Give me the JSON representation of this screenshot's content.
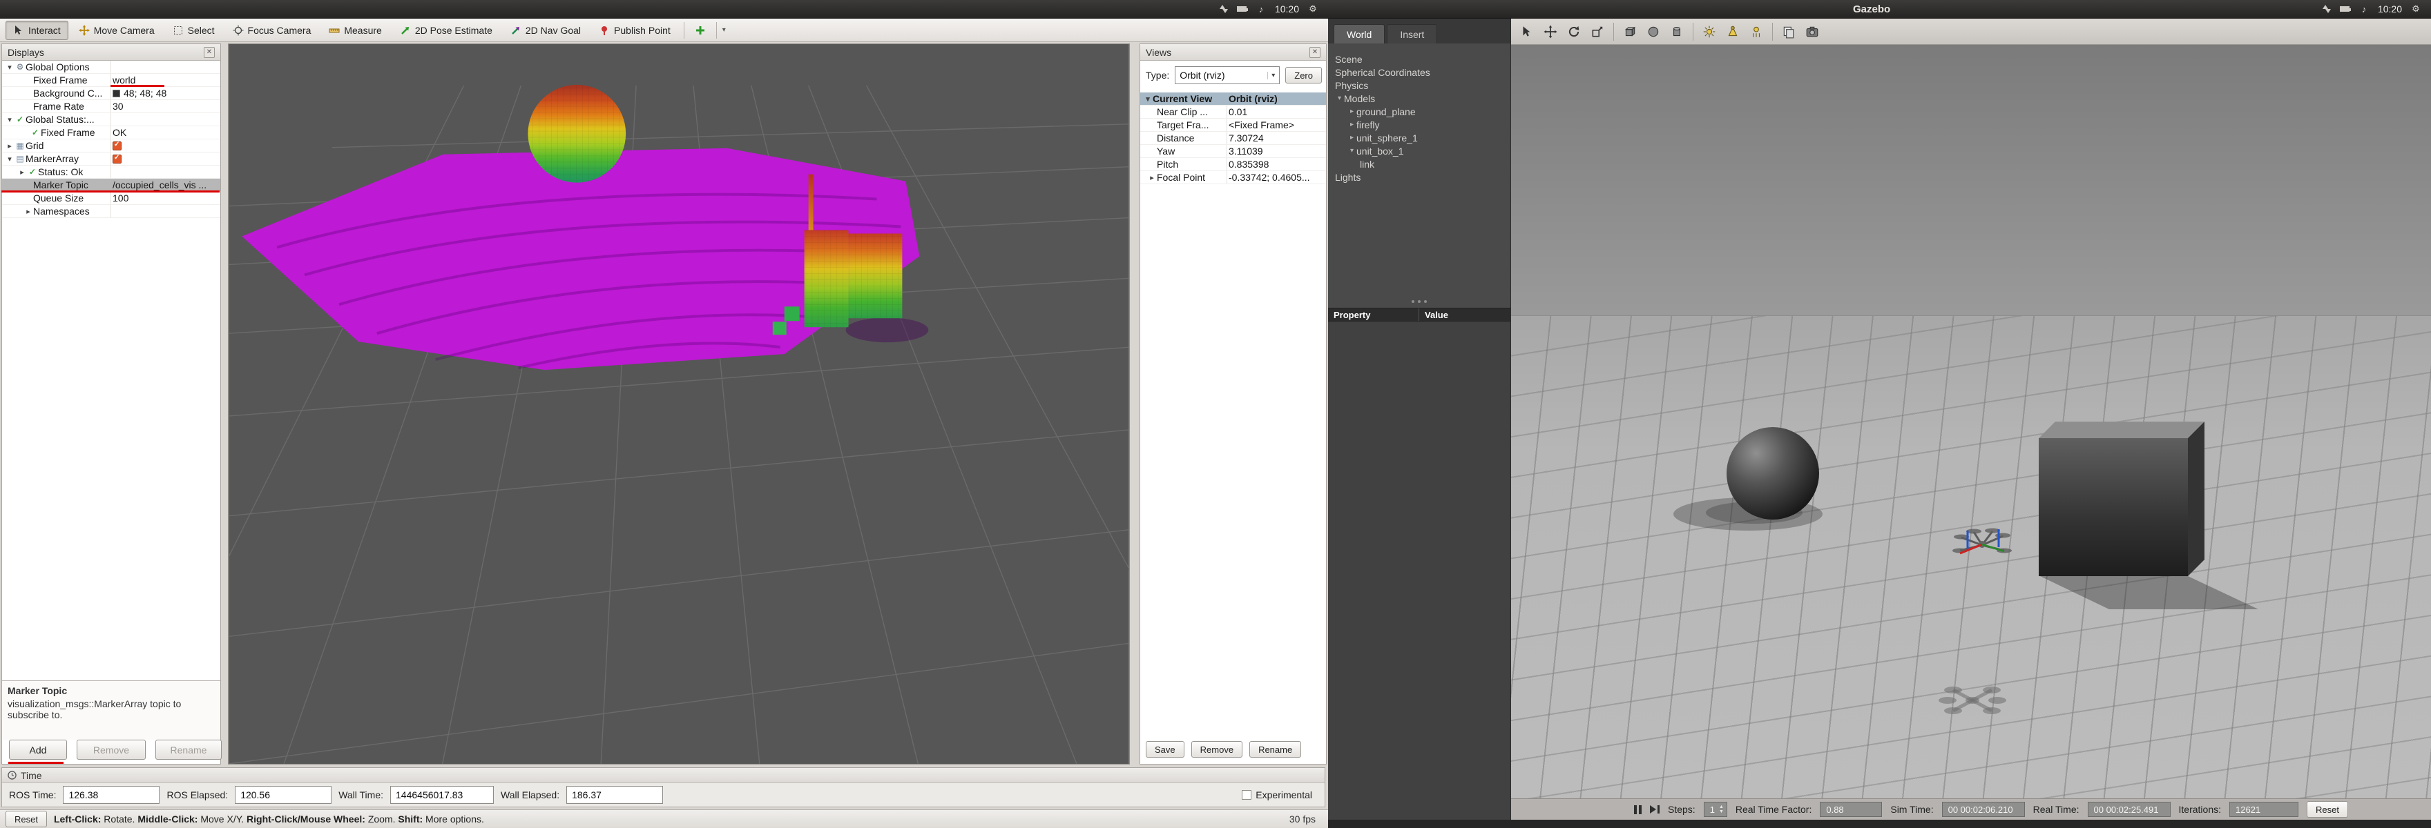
{
  "panel": {
    "gazebo_title": "Gazebo",
    "clock_left": "10:20",
    "clock_right": "10:20"
  },
  "icons": [
    "interact-icon",
    "move-camera-icon",
    "select-icon",
    "focus-camera-icon",
    "measure-icon",
    "pose-estimate-icon",
    "nav-goal-icon",
    "publish-point-icon",
    "add-tool-icon",
    "chevron-down-icon",
    "close-icon",
    "gear-icon",
    "grid-icon",
    "markerarray-icon",
    "status-check-icon",
    "expander-icon",
    "clock-icon",
    "network-icon",
    "battery-icon",
    "sound-icon",
    "session-gear-icon",
    "select-arrow-icon",
    "translate-icon",
    "rotate-icon",
    "scale-icon",
    "cube-icon",
    "sphere-icon",
    "cylinder-icon",
    "pointlight-icon",
    "spotlight-icon",
    "directionallight-icon",
    "screenshot-icon",
    "copy-icon",
    "pause-icon",
    "step-icon"
  ],
  "rviz": {
    "toolbar": {
      "buttons": [
        "Interact",
        "Move Camera",
        "Select",
        "Focus Camera",
        "Measure",
        "2D Pose Estimate",
        "2D Nav Goal",
        "Publish Point"
      ]
    },
    "displays": {
      "title": "Displays",
      "rows": [
        {
          "label": "Global Options"
        },
        {
          "label": "Fixed Frame",
          "value": "world"
        },
        {
          "label": "Background C...",
          "value": "48; 48; 48"
        },
        {
          "label": "Frame Rate",
          "value": "30"
        },
        {
          "label": "Global Status:..."
        },
        {
          "label": "Fixed Frame",
          "value": "OK"
        },
        {
          "label": "Grid"
        },
        {
          "label": "MarkerArray"
        },
        {
          "label": "Status: Ok"
        },
        {
          "label": "Marker Topic",
          "value": "/occupied_cells_vis ..."
        },
        {
          "label": "Queue Size",
          "value": "100"
        },
        {
          "label": "Namespaces"
        }
      ],
      "help_title": "Marker Topic",
      "help_body": "visualization_msgs::MarkerArray topic to subscribe to.",
      "add": "Add",
      "remove": "Remove",
      "rename": "Rename"
    },
    "views": {
      "title": "Views",
      "type_label": "Type:",
      "type_value": "Orbit (rviz)",
      "zero": "Zero",
      "rows": [
        {
          "label": "Current View",
          "value": "Orbit (rviz)"
        },
        {
          "label": "Near Clip ...",
          "value": "0.01"
        },
        {
          "label": "Target Fra...",
          "value": "<Fixed Frame>"
        },
        {
          "label": "Distance",
          "value": "7.30724"
        },
        {
          "label": "Yaw",
          "value": "3.11039"
        },
        {
          "label": "Pitch",
          "value": "0.835398"
        },
        {
          "label": "Focal Point",
          "value": "-0.33742; 0.4605..."
        }
      ],
      "save": "Save",
      "remove": "Remove",
      "rename": "Rename"
    },
    "time_panel": {
      "title": "Time",
      "ros_time_label": "ROS Time:",
      "ros_time": "126.38",
      "ros_elapsed_label": "ROS Elapsed:",
      "ros_elapsed": "120.56",
      "wall_time_label": "Wall Time:",
      "wall_time": "1446456017.83",
      "wall_elapsed_label": "Wall Elapsed:",
      "wall_elapsed": "186.37",
      "experimental": "Experimental"
    },
    "statusbar": {
      "reset": "Reset",
      "hint": [
        {
          "key": "Left-Click:",
          "text": " Rotate.  "
        },
        {
          "key": "Middle-Click:",
          "text": " Move X/Y.  "
        },
        {
          "key": "Right-Click/Mouse Wheel:",
          "text": " Zoom.  "
        },
        {
          "key": "Shift:",
          "text": " More options."
        }
      ],
      "fps": "30 fps"
    }
  },
  "gazebo": {
    "tabs": {
      "world": "World",
      "insert": "Insert"
    },
    "tree": [
      "Scene",
      "Spherical Coordinates",
      "Physics",
      "Models",
      "ground_plane",
      "firefly",
      "unit_sphere_1",
      "unit_box_1",
      "link",
      "Lights"
    ],
    "property_header": {
      "property": "Property",
      "value": "Value"
    },
    "statusbar": {
      "steps_label": "Steps:",
      "steps_value": "1",
      "rtf_label": "Real Time Factor:",
      "rtf_value": "0.88",
      "sim_label": "Sim Time:",
      "sim_value": "00 00:02:06.210",
      "real_label": "Real Time:",
      "real_value": "00 00:02:25.491",
      "iter_label": "Iterations:",
      "iter_value": "12621",
      "reset": "Reset"
    }
  }
}
